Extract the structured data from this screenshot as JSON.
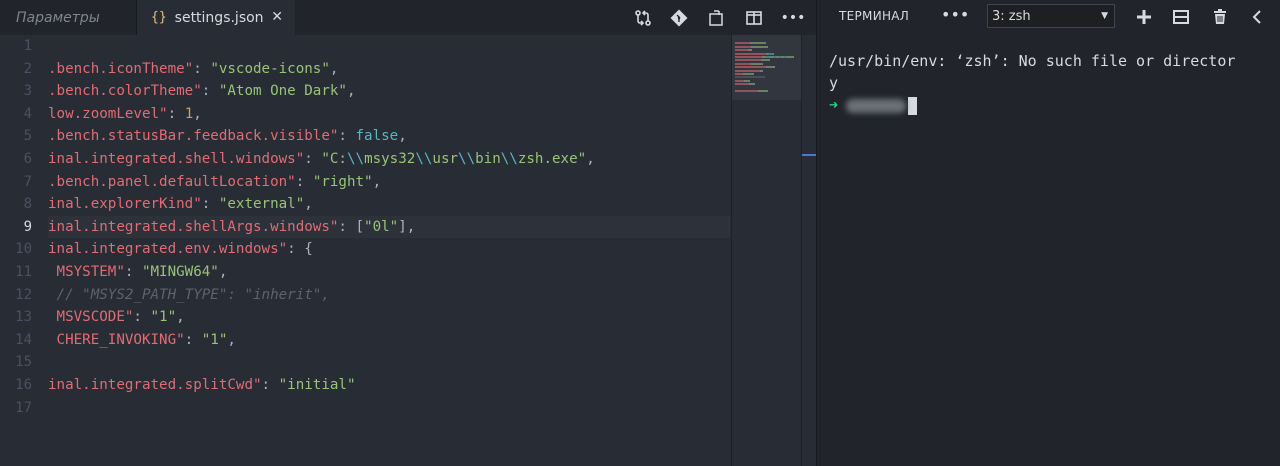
{
  "tabs": [
    {
      "label": "Параметры",
      "active": false
    },
    {
      "label": "settings.json",
      "active": true,
      "icon": "{}",
      "close": "✕"
    }
  ],
  "editor": {
    "line_numbers": [
      "1",
      "2",
      "3",
      "4",
      "5",
      "6",
      "7",
      "8",
      "9",
      "10",
      "11",
      "12",
      "13",
      "14",
      "15",
      "16",
      "17"
    ],
    "active_line": 9,
    "lines": [
      [],
      [
        {
          "t": ".bench.iconTheme\"",
          "c": "k"
        },
        {
          "t": ": ",
          "c": "p"
        },
        {
          "t": "\"vscode-icons\"",
          "c": "s"
        },
        {
          "t": ",",
          "c": "p"
        }
      ],
      [
        {
          "t": ".bench.colorTheme\"",
          "c": "k"
        },
        {
          "t": ": ",
          "c": "p"
        },
        {
          "t": "\"Atom One Dark\"",
          "c": "s"
        },
        {
          "t": ",",
          "c": "p"
        }
      ],
      [
        {
          "t": "low.zoomLevel\"",
          "c": "k"
        },
        {
          "t": ": ",
          "c": "p"
        },
        {
          "t": "1",
          "c": "n"
        },
        {
          "t": ",",
          "c": "p"
        }
      ],
      [
        {
          "t": ".bench.statusBar.feedback.visible\"",
          "c": "k"
        },
        {
          "t": ": ",
          "c": "p"
        },
        {
          "t": "false",
          "c": "b"
        },
        {
          "t": ",",
          "c": "p"
        }
      ],
      [
        {
          "t": "inal.integrated.shell.windows\"",
          "c": "k"
        },
        {
          "t": ": ",
          "c": "p"
        },
        {
          "t": "\"C:",
          "c": "s"
        },
        {
          "t": "\\\\",
          "c": "b"
        },
        {
          "t": "msys32",
          "c": "s"
        },
        {
          "t": "\\\\",
          "c": "b"
        },
        {
          "t": "usr",
          "c": "s"
        },
        {
          "t": "\\\\",
          "c": "b"
        },
        {
          "t": "bin",
          "c": "s"
        },
        {
          "t": "\\\\",
          "c": "b"
        },
        {
          "t": "zsh.exe\"",
          "c": "s"
        },
        {
          "t": ",",
          "c": "p"
        }
      ],
      [
        {
          "t": ".bench.panel.defaultLocation\"",
          "c": "k"
        },
        {
          "t": ": ",
          "c": "p"
        },
        {
          "t": "\"right\"",
          "c": "s"
        },
        {
          "t": ",",
          "c": "p"
        }
      ],
      [
        {
          "t": "inal.explorerKind\"",
          "c": "k"
        },
        {
          "t": ": ",
          "c": "p"
        },
        {
          "t": "\"external\"",
          "c": "s"
        },
        {
          "t": ",",
          "c": "p"
        }
      ],
      [
        {
          "t": "inal.integrated.shellArgs.windows\"",
          "c": "k"
        },
        {
          "t": ": [",
          "c": "p"
        },
        {
          "t": "\"0l\"",
          "c": "s"
        },
        {
          "t": "],",
          "c": "p"
        }
      ],
      [
        {
          "t": "inal.integrated.env.windows\"",
          "c": "k"
        },
        {
          "t": ": {",
          "c": "p"
        }
      ],
      [
        {
          "t": " MSYSTEM\"",
          "c": "k"
        },
        {
          "t": ": ",
          "c": "p"
        },
        {
          "t": "\"MINGW64\"",
          "c": "s"
        },
        {
          "t": ",",
          "c": "p"
        }
      ],
      [
        {
          "t": " // \"MSYS2_PATH_TYPE\": \"inherit\",",
          "c": "c"
        }
      ],
      [
        {
          "t": " MSVSCODE\"",
          "c": "k"
        },
        {
          "t": ": ",
          "c": "p"
        },
        {
          "t": "\"1\"",
          "c": "s"
        },
        {
          "t": ",",
          "c": "p"
        }
      ],
      [
        {
          "t": " CHERE_INVOKING\"",
          "c": "k"
        },
        {
          "t": ": ",
          "c": "p"
        },
        {
          "t": "\"1\"",
          "c": "s"
        },
        {
          "t": ",",
          "c": "p"
        }
      ],
      [],
      [
        {
          "t": "inal.integrated.splitCwd\"",
          "c": "k"
        },
        {
          "t": ": ",
          "c": "p"
        },
        {
          "t": "\"initial\"",
          "c": "s"
        }
      ],
      []
    ]
  },
  "editor_toolbar": {
    "icons": [
      "git-compare-icon",
      "git-branch-icon",
      "open-preview-icon",
      "split-editor-icon",
      "more-actions-icon"
    ]
  },
  "panel": {
    "title": "ТЕРМИНАЛ",
    "more": "•••",
    "terminal_select": "3: zsh",
    "icons": [
      "add-terminal-icon",
      "split-terminal-icon",
      "kill-terminal-icon",
      "collapse-panel-icon"
    ]
  },
  "terminal": {
    "lines": [
      "/usr/bin/env: ‘zsh’: No such file or director",
      "y"
    ],
    "prompt": "➜"
  },
  "colors": {
    "string": "#98c379",
    "key": "#e06c75",
    "number": "#d19a66",
    "builtin": "#56b6c2",
    "comment": "#5c6370",
    "prompt": "#23d18b"
  }
}
